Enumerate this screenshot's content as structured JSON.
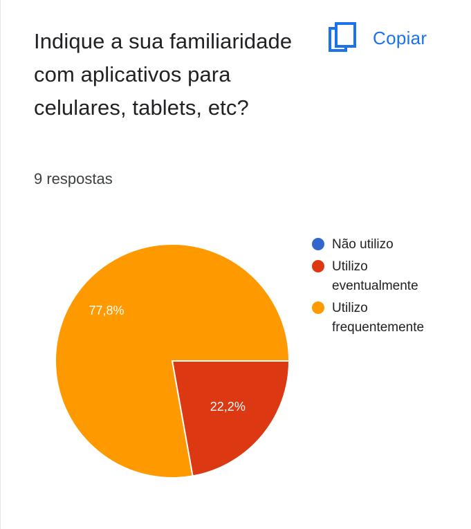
{
  "question": {
    "title": "Indique a sua familiaridade com aplicativos para celulares, tablets, etc?",
    "responses": "9 respostas"
  },
  "copy_button": {
    "label": "Copiar",
    "icon": "copy-icon",
    "color": "#1a73e8"
  },
  "chart_data": {
    "type": "pie",
    "title": "",
    "categories": [
      "Não utilizo",
      "Utilizo eventualmente",
      "Utilizo frequentemente"
    ],
    "values": [
      0,
      22.2,
      77.8
    ],
    "data_labels": [
      "",
      "22,2%",
      "77,8%"
    ],
    "colors": [
      "#3366cc",
      "#dc3912",
      "#ff9900"
    ],
    "legend_position": "right"
  }
}
